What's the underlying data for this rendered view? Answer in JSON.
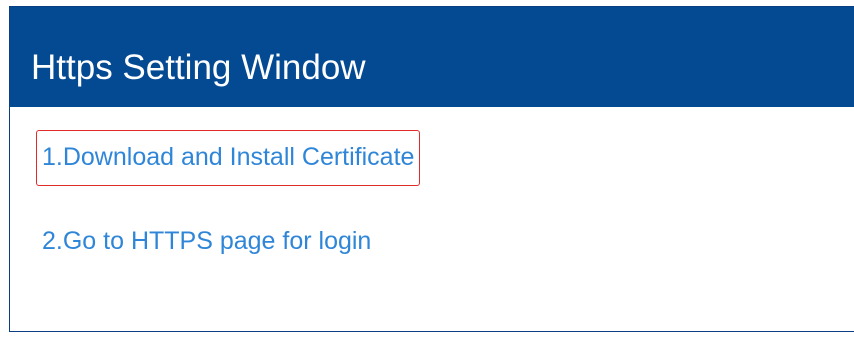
{
  "window": {
    "title": "Https Setting Window"
  },
  "links": {
    "download_certificate": "1.Download and Install Certificate",
    "go_https_login": "2.Go to HTTPS page for login"
  },
  "colors": {
    "title_bar": "#044a92",
    "link_text": "#2f86d8",
    "highlight_border": "#e02b2b"
  }
}
